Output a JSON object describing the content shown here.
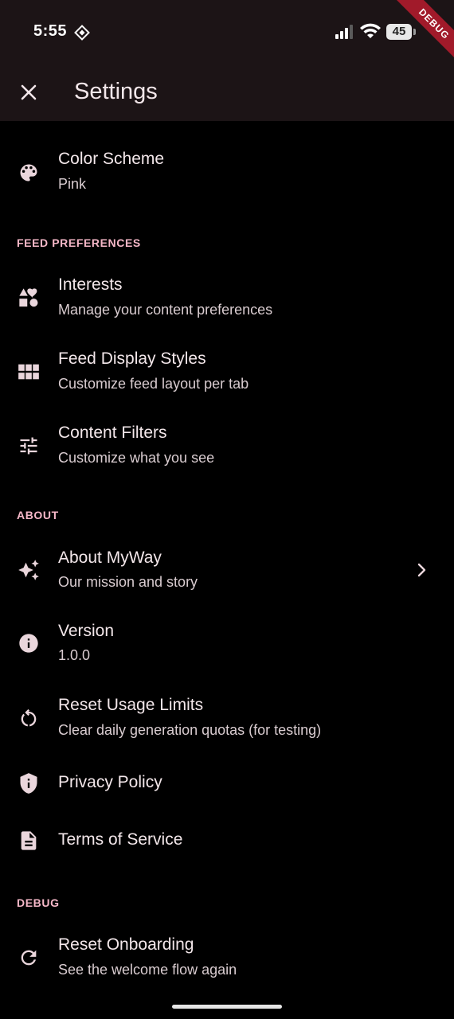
{
  "status_bar": {
    "time": "5:55",
    "battery_level": "45"
  },
  "debug_banner": "DEBUG",
  "app_bar": {
    "title": "Settings"
  },
  "items": {
    "color_scheme": {
      "title": "Color Scheme",
      "subtitle": "Pink",
      "icon": "palette-icon"
    },
    "interests": {
      "title": "Interests",
      "subtitle": "Manage your content preferences",
      "icon": "category-icon"
    },
    "feed_display": {
      "title": "Feed Display Styles",
      "subtitle": "Customize feed layout per tab",
      "icon": "grid-icon"
    },
    "content_filters": {
      "title": "Content Filters",
      "subtitle": "Customize what you see",
      "icon": "tune-icon"
    },
    "about": {
      "title": "About MyWay",
      "subtitle": "Our mission and story",
      "icon": "sparkle-icon"
    },
    "version": {
      "title": "Version",
      "subtitle": "1.0.0",
      "icon": "info-icon"
    },
    "reset_usage": {
      "title": "Reset Usage Limits",
      "subtitle": "Clear daily generation quotas (for testing)",
      "icon": "restart-icon"
    },
    "privacy": {
      "title": "Privacy Policy",
      "icon": "shield-icon"
    },
    "terms": {
      "title": "Terms of Service",
      "icon": "document-icon"
    },
    "reset_onboarding": {
      "title": "Reset Onboarding",
      "subtitle": "See the welcome flow again",
      "icon": "refresh-icon"
    }
  },
  "sections": {
    "feed_preferences": "FEED PREFERENCES",
    "about": "ABOUT",
    "debug": "DEBUG"
  },
  "colors": {
    "background": "#000000",
    "app_bar": "#1c1416",
    "accent_pink": "#f6b8c8",
    "icon": "#ead6dc",
    "debug_banner": "#a11a2a"
  }
}
